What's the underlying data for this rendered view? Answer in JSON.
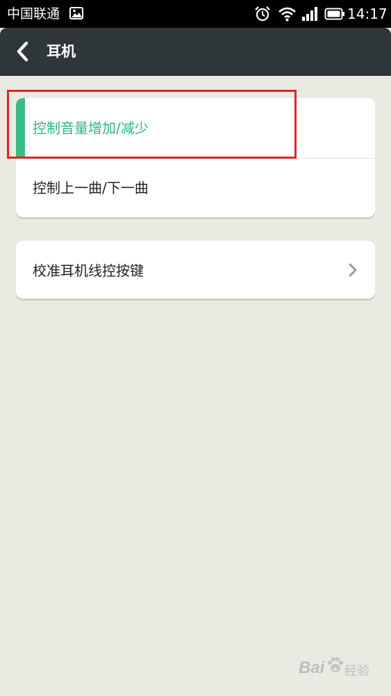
{
  "status_bar": {
    "carrier": "中国联通",
    "time": "14:17",
    "icons": [
      "gallery-icon",
      "alarm-icon",
      "wifi-icon",
      "signal-icon",
      "battery-icon"
    ]
  },
  "header": {
    "title": "耳机",
    "back_icon": "chevron-left-icon"
  },
  "groups": [
    {
      "items": [
        {
          "label": "控制音量增加/减少",
          "selected": true
        },
        {
          "label": "控制上一曲/下一曲",
          "selected": false
        }
      ]
    },
    {
      "items": [
        {
          "label": "校准耳机线控按键",
          "has_arrow": true
        }
      ]
    }
  ],
  "colors": {
    "accent": "#3cba87",
    "selected_text": "#2eb579",
    "background": "#ebeae2",
    "title_bar": "#2f363a",
    "annotation": "#e02424"
  },
  "watermark": {
    "logo": "Bai",
    "logo_suffix": "du",
    "text": "经验"
  }
}
